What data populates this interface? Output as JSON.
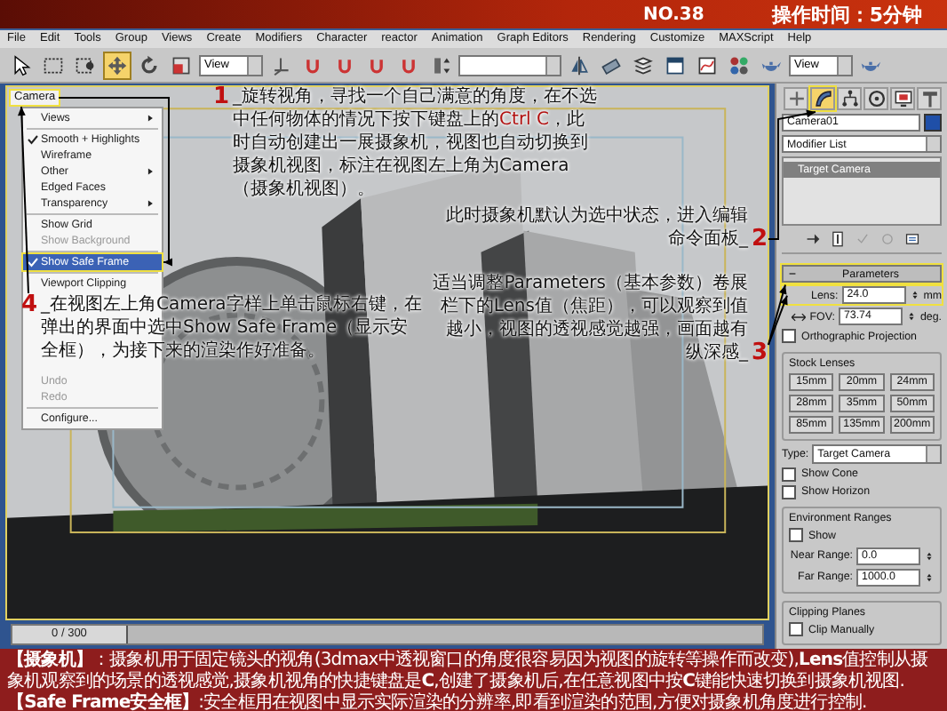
{
  "header": {
    "issue": "NO.38",
    "duration": "操作时间：5分钟"
  },
  "menu_bar": [
    "File",
    "Edit",
    "Tools",
    "Group",
    "Views",
    "Create",
    "Modifiers",
    "Character",
    "reactor",
    "Animation",
    "Graph Editors",
    "Rendering",
    "Customize",
    "MAXScript",
    "Help"
  ],
  "toolbar": [
    {
      "kind": "tool",
      "selected": false
    },
    {
      "kind": "tool",
      "selected": false
    },
    {
      "kind": "tool",
      "selected": false
    },
    {
      "kind": "tool",
      "selected": true
    },
    {
      "kind": "tool",
      "selected": false
    },
    {
      "kind": "tool",
      "selected": false
    },
    {
      "kind": "dropdown",
      "value": "View"
    },
    {
      "kind": "tool",
      "selected": false
    },
    {
      "kind": "tool",
      "selected": false
    },
    {
      "kind": "tool",
      "selected": false
    },
    {
      "kind": "tool",
      "selected": false
    },
    {
      "kind": "tool",
      "selected": false
    },
    {
      "kind": "tool",
      "selected": false
    },
    {
      "kind": "dropdown"
    },
    {
      "kind": "tool",
      "selected": false
    },
    {
      "kind": "tool",
      "selected": false
    },
    {
      "kind": "tool",
      "selected": false
    },
    {
      "kind": "tool",
      "selected": false
    },
    {
      "kind": "tool",
      "selected": false
    },
    {
      "kind": "tool",
      "selected": false
    },
    {
      "kind": "tool",
      "selected": false
    },
    {
      "kind": "dropdown",
      "value": "View"
    },
    {
      "kind": "tool",
      "selected": false
    }
  ],
  "viewport": {
    "label": "Camera",
    "highlighted": true
  },
  "context_menu": {
    "items_above": [
      {
        "kind": "item",
        "label": "Views",
        "submenu": true,
        "checked": false,
        "disabled": false,
        "selected": false,
        "highlighted": false
      },
      {
        "kind": "separator"
      },
      {
        "kind": "item",
        "label": "Smooth + Highlights",
        "submenu": false,
        "checked": true,
        "disabled": false,
        "selected": false,
        "highlighted": false
      },
      {
        "kind": "item",
        "label": "Wireframe",
        "submenu": false,
        "checked": false,
        "disabled": false,
        "selected": false,
        "highlighted": false
      },
      {
        "kind": "item",
        "label": "Other",
        "submenu": true,
        "checked": false,
        "disabled": false,
        "selected": false,
        "highlighted": false
      },
      {
        "kind": "item",
        "label": "Edged Faces",
        "submenu": false,
        "checked": false,
        "disabled": false,
        "selected": false,
        "highlighted": false
      },
      {
        "kind": "item",
        "label": "Transparency",
        "submenu": true,
        "checked": false,
        "disabled": false,
        "selected": false,
        "highlighted": false
      },
      {
        "kind": "separator"
      },
      {
        "kind": "item",
        "label": "Show Grid",
        "submenu": false,
        "checked": false,
        "disabled": false,
        "selected": false,
        "highlighted": false
      },
      {
        "kind": "item",
        "label": "Show Background",
        "submenu": false,
        "checked": false,
        "disabled": true,
        "selected": false,
        "highlighted": false
      },
      {
        "kind": "separator"
      },
      {
        "kind": "item",
        "label": "Show Safe Frame",
        "submenu": false,
        "checked": true,
        "disabled": false,
        "selected": true,
        "highlighted": true
      },
      {
        "kind": "separator"
      },
      {
        "kind": "item",
        "label": "Viewport Clipping",
        "submenu": false,
        "checked": false,
        "disabled": false,
        "selected": false,
        "highlighted": false
      }
    ],
    "items_below": [
      {
        "kind": "item",
        "label": "Undo",
        "submenu": false,
        "checked": false,
        "disabled": true,
        "selected": false,
        "highlighted": false
      },
      {
        "kind": "item",
        "label": "Redo",
        "submenu": false,
        "checked": false,
        "disabled": true,
        "selected": false,
        "highlighted": false
      },
      {
        "kind": "separator"
      },
      {
        "kind": "item",
        "label": "Configure...",
        "submenu": false,
        "checked": false,
        "disabled": false,
        "selected": false,
        "highlighted": false
      }
    ]
  },
  "annotations": [
    {
      "kind": "lead",
      "number": "1",
      "text": "_旋转视角，寻找一个自己满意的角度，在不选中任何物体的情况下按下键盘上的**Ctrl C**，此时自动创建出一展摄象机，视图也自动切换到摄象机视图，标注在视图左上角为Camera（摄象机视图）。"
    },
    {
      "kind": "trail",
      "number": "2",
      "text": "此时摄象机默认为选中状态，进入编辑命令面板_"
    },
    {
      "kind": "lead",
      "number": "4",
      "text": "_在视图左上角Camera字样上单击鼠标右键，在弹出的界面中选中Show Safe Frame（显示安全框），为接下来的渲染作好准备。"
    },
    {
      "kind": "trail",
      "number": "3",
      "text": "适当调整Parameters（基本参数）卷展栏下的Lens值（焦距），可以观察到值越小，视图的透视感觉越强，画面越有纵深感_"
    }
  ],
  "time_slider": {
    "frame": "0 / 300",
    "level": 0
  },
  "command_panel": {
    "tabs": [
      {
        "selected": false,
        "highlighted": false
      },
      {
        "selected": true,
        "highlighted": true
      },
      {
        "selected": false,
        "highlighted": false
      },
      {
        "selected": false,
        "highlighted": false
      },
      {
        "selected": false,
        "highlighted": false
      },
      {
        "selected": false,
        "highlighted": false
      }
    ],
    "object_name": "Camera01",
    "modifier_list": "Modifier List",
    "stack": [
      {
        "label": "Target Camera",
        "selected": true
      }
    ],
    "parameters": {
      "title": "Parameters",
      "highlighted": true,
      "lens_label": "Lens:",
      "lens": "24.0",
      "lens_unit": "mm",
      "lens_highlighted": true,
      "fov_label": "FOV:",
      "fov": "73.74",
      "fov_unit": "deg.",
      "orthographic": {
        "label": "Orthographic Projection",
        "checked": false
      },
      "stock_lenses_title": "Stock Lenses",
      "stock_lenses": [
        "15mm",
        "20mm",
        "24mm",
        "28mm",
        "35mm",
        "50mm",
        "85mm",
        "135mm",
        "200mm"
      ],
      "type_label": "Type:",
      "type": "Target Camera",
      "show_cone": {
        "label": "Show Cone",
        "checked": false
      },
      "show_horizon": {
        "label": "Show Horizon",
        "checked": false
      },
      "environment": {
        "title": "Environment Ranges",
        "show": {
          "label": "Show",
          "checked": false
        },
        "near_label": "Near Range:",
        "near": "0.0",
        "far_label": "Far Range:",
        "far": "1000.0"
      },
      "clipping": {
        "title": "Clipping Planes",
        "clip_manually": {
          "label": "Clip Manually",
          "checked": false
        }
      }
    }
  },
  "info": [
    "**【摄象机】**：摄象机用于固定镜头的视角(3dmax中透视窗口的角度很容易因为视图的旋转等操作而改变),**Lens**值控制从摄象机观察到的场景的透视感觉,摄象机视角的快捷键盘是**C**,创建了摄象机后,在任意视图中按**C**键能快速切换到摄象机视图.",
    "**【Safe Frame安全框】**:安全框用在视图中显示实际渲染的分辨率,即看到渲染的范围,方便对摄象机角度进行控制."
  ]
}
